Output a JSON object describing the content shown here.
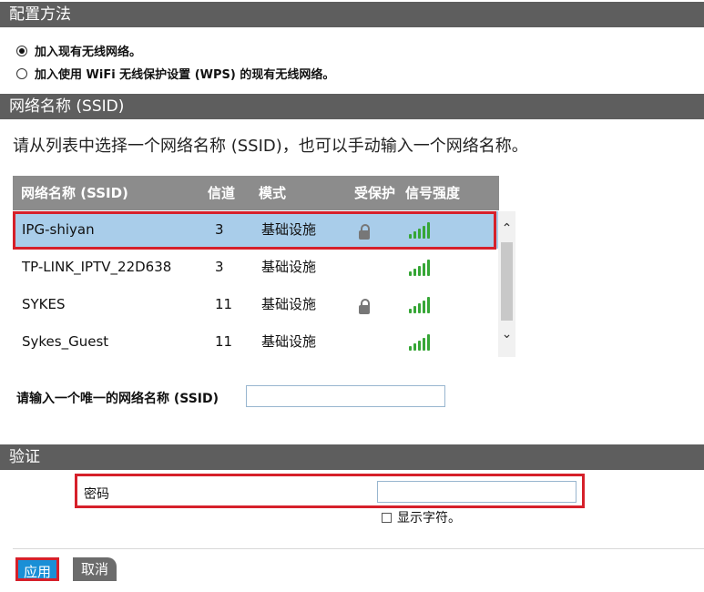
{
  "config_section": {
    "title": "配置方法",
    "options": [
      {
        "label": "加入现有无线网络。",
        "checked": true
      },
      {
        "label": "加入使用 WiFi 无线保护设置 (WPS) 的现有无线网络。",
        "checked": false
      }
    ]
  },
  "ssid_section": {
    "title": "网络名称 (SSID)",
    "intro": "请从列表中选择一个网络名称 (SSID)，也可以手动输入一个网络名称。",
    "columns": [
      "网络名称 (SSID)",
      "信道",
      "模式",
      "受保护",
      "信号强度"
    ],
    "networks": [
      {
        "ssid": "IPG-shiyan",
        "channel": "3",
        "mode": "基础设施",
        "protected": true,
        "signal": "full",
        "selected": true
      },
      {
        "ssid": "TP-LINK_IPTV_22D638",
        "channel": "3",
        "mode": "基础设施",
        "protected": false,
        "signal": "full",
        "selected": false
      },
      {
        "ssid": "SYKES",
        "channel": "11",
        "mode": "基础设施",
        "protected": true,
        "signal": "full",
        "selected": false
      },
      {
        "ssid": "Sykes_Guest",
        "channel": "11",
        "mode": "基础设施",
        "protected": false,
        "signal": "full",
        "selected": false
      }
    ],
    "manual_label": "请输入一个唯一的网络名称 (SSID)",
    "manual_value": ""
  },
  "auth_section": {
    "title": "验证",
    "password_label": "密码",
    "password_value": "",
    "show_chars_label": "显示字符。",
    "show_chars_checked": false
  },
  "buttons": {
    "apply": "应用",
    "cancel": "取消"
  },
  "colors": {
    "header_bg": "#5e5e5e",
    "table_header_bg": "#8c8c8c",
    "selected_row": "#a9cdea",
    "highlight_red": "#d6202a",
    "apply_blue": "#1a8fd6",
    "signal_green": "#36a636"
  },
  "icons": {
    "protected": "lock-icon",
    "signal": "signal-strength-icon",
    "scroll_up": "chevron-up-icon",
    "scroll_down": "chevron-down-icon"
  }
}
